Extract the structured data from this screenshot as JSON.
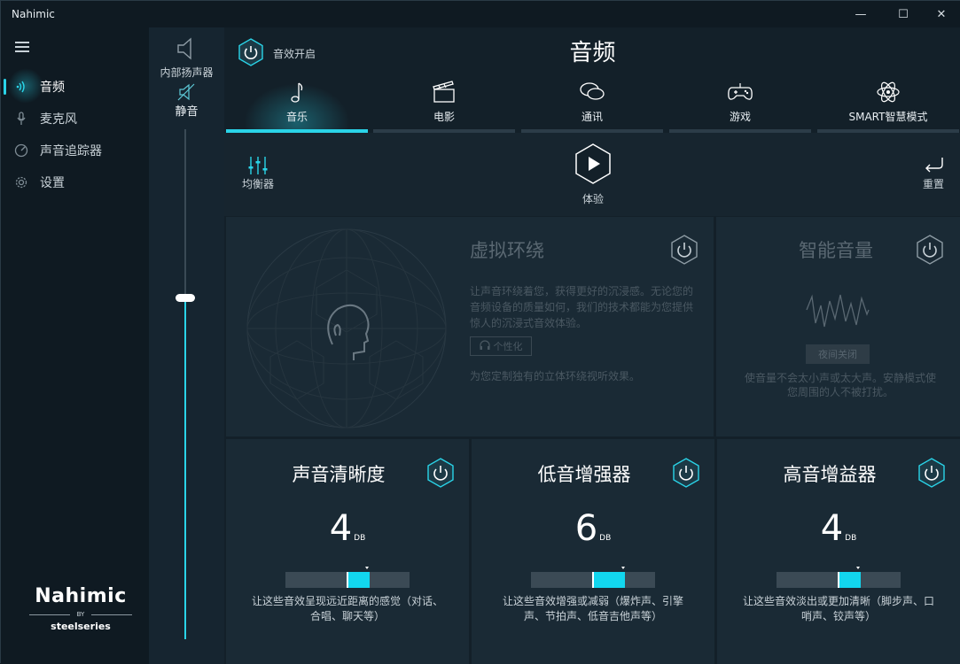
{
  "window": {
    "title": "Nahimic",
    "min": "—",
    "max": "☐",
    "close": "✕"
  },
  "sidebar": {
    "items": [
      {
        "label": "音频",
        "icon": "audio-waves-icon",
        "active": true
      },
      {
        "label": "麦克风",
        "icon": "microphone-icon",
        "active": false
      },
      {
        "label": "声音追踪器",
        "icon": "sound-tracker-icon",
        "active": false
      },
      {
        "label": "设置",
        "icon": "gear-icon",
        "active": false
      }
    ],
    "logo": {
      "brand": "Nahimic",
      "by": "BY",
      "partner": "steelseries"
    }
  },
  "volume": {
    "device": "内部扬声器",
    "mute_label": "静音",
    "level_fraction": 0.67
  },
  "main": {
    "master_label": "音效开启",
    "title": "音频",
    "tabs": [
      {
        "label": "音乐",
        "icon": "music-note-icon",
        "active": true
      },
      {
        "label": "电影",
        "icon": "clapperboard-icon",
        "active": false
      },
      {
        "label": "通讯",
        "icon": "chat-bubbles-icon",
        "active": false
      },
      {
        "label": "游戏",
        "icon": "gamepad-icon",
        "active": false
      },
      {
        "label": "SMART智慧模式",
        "icon": "atom-icon",
        "active": false
      }
    ],
    "toolbar": {
      "equalizer": "均衡器",
      "play": "体验",
      "reset": "重置"
    },
    "virtual_surround": {
      "title": "虚拟环绕",
      "desc": "让声音环绕着您，获得更好的沉浸感。无论您的音频设备的质量如何，我们的技术都能为您提供惊人的沉浸式音效体验。",
      "custom": "个性化",
      "note": "为您定制独有的立体环绕视听效果。"
    },
    "smart_volume": {
      "title": "智能音量",
      "button": "夜间关闭",
      "desc": "使音量不会太小声或太大声。安静模式使您周围的人不被打扰。"
    },
    "effects": [
      {
        "title": "声音清晰度",
        "value": "4",
        "unit": "DB",
        "desc": "让这些音效呈现远近距离的感觉（对话、合唱、聊天等）"
      },
      {
        "title": "低音增强器",
        "value": "6",
        "unit": "DB",
        "desc": "让这些音效增强或减弱（爆炸声、引擎声、节拍声、低音吉他声等）"
      },
      {
        "title": "高音增益器",
        "value": "4",
        "unit": "DB",
        "desc": "让这些音效淡出或更加清晰（脚步声、口哨声、铰声等）"
      }
    ]
  }
}
